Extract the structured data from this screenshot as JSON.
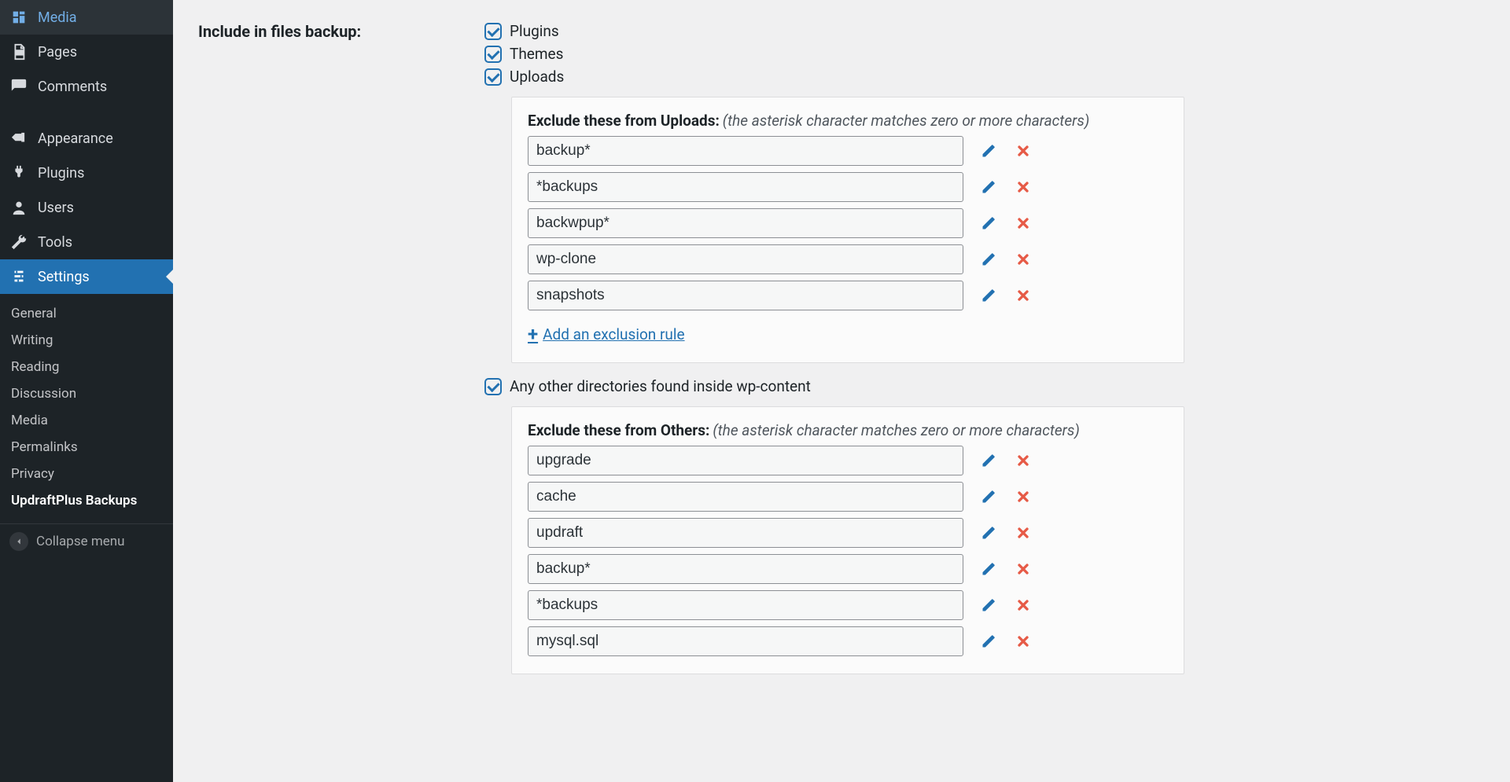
{
  "sidebar": {
    "menu": [
      {
        "id": "media",
        "label": "Media"
      },
      {
        "id": "pages",
        "label": "Pages"
      },
      {
        "id": "comments",
        "label": "Comments"
      },
      {
        "id": "appearance",
        "label": "Appearance"
      },
      {
        "id": "plugins",
        "label": "Plugins"
      },
      {
        "id": "users",
        "label": "Users"
      },
      {
        "id": "tools",
        "label": "Tools"
      },
      {
        "id": "settings",
        "label": "Settings"
      }
    ],
    "submenu": [
      "General",
      "Writing",
      "Reading",
      "Discussion",
      "Media",
      "Permalinks",
      "Privacy",
      "UpdraftPlus Backups"
    ],
    "collapse_label": "Collapse menu"
  },
  "section_label": "Include in files backup:",
  "checkboxes": {
    "plugins": "Plugins",
    "themes": "Themes",
    "uploads": "Uploads",
    "others": "Any other directories found inside wp-content"
  },
  "uploads_box": {
    "title": "Exclude these from Uploads:",
    "hint": "(the asterisk character matches zero or more characters)",
    "rules": [
      "backup*",
      "*backups",
      "backwpup*",
      "wp-clone",
      "snapshots"
    ],
    "add_label": "Add an exclusion rule"
  },
  "others_box": {
    "title": "Exclude these from Others:",
    "hint": "(the asterisk character matches zero or more characters)",
    "rules": [
      "upgrade",
      "cache",
      "updraft",
      "backup*",
      "*backups",
      "mysql.sql"
    ]
  }
}
